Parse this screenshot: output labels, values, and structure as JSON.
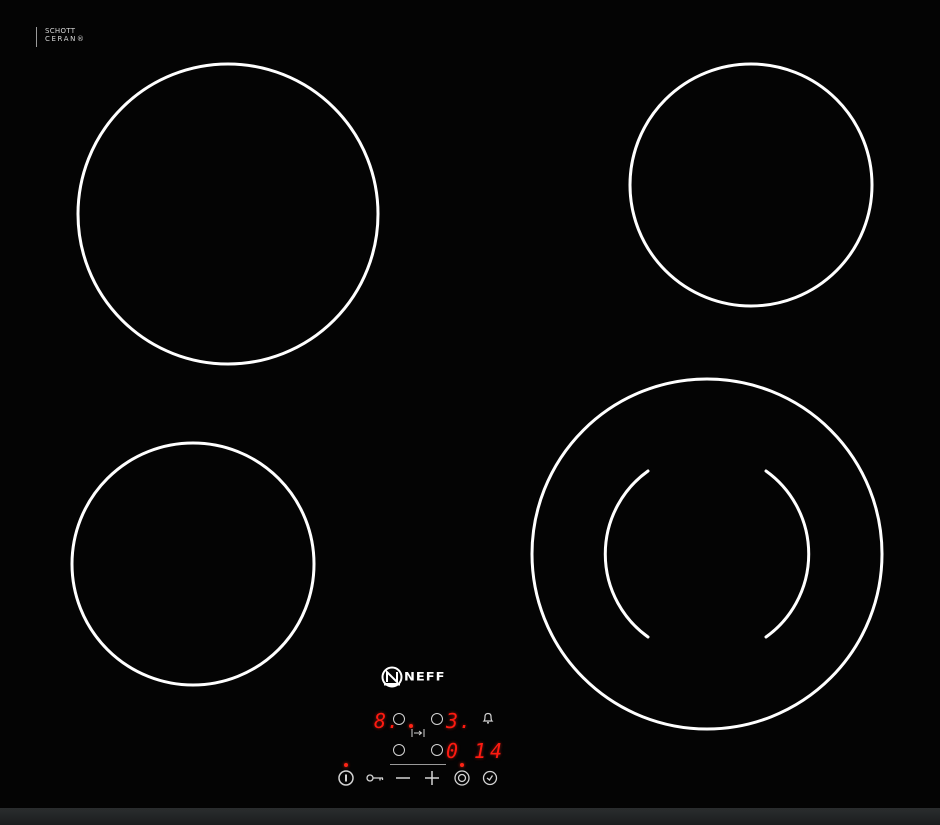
{
  "glass_brand": {
    "line1": "SCHOTT",
    "line2": "CERAN®"
  },
  "appliance_brand": "NEFF",
  "zones": [
    {
      "id": "front-left-large",
      "type": "single"
    },
    {
      "id": "rear-right-small",
      "type": "single"
    },
    {
      "id": "rear-left-medium",
      "type": "single"
    },
    {
      "id": "front-right-dual",
      "type": "dual"
    }
  ],
  "display": {
    "zone_top_left_level": "8.",
    "zone_top_right_level": "3.",
    "zone_bottom_right_level": "0",
    "timer_value": "14"
  },
  "controls": {
    "power": "power-icon",
    "lock": "key-lock-icon",
    "minus": "minus-icon",
    "plus": "plus-icon",
    "dual_zone": "dual-zone-icon",
    "timer": "timer-icon",
    "alarm": "bell-icon",
    "next_zone": "next-zone-icon"
  },
  "colors": {
    "glass": "#040404",
    "rings": "#ffffff",
    "display_red": "#ff1a10",
    "symbols": "#d4d4d4"
  }
}
